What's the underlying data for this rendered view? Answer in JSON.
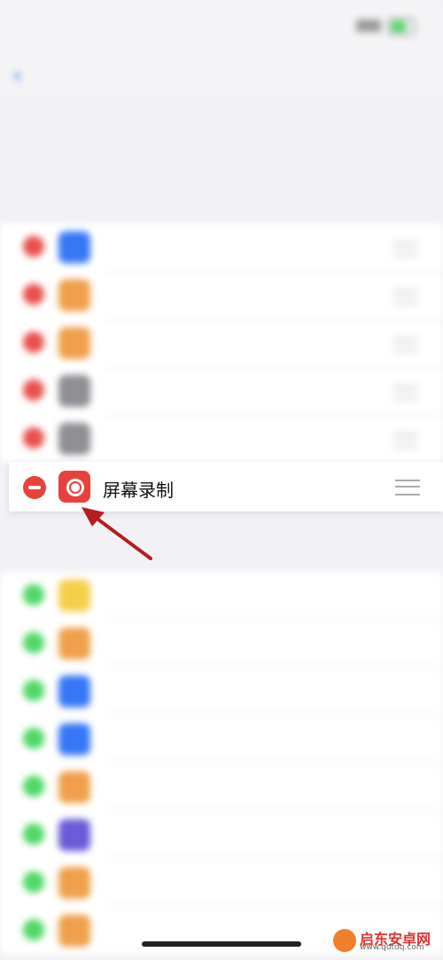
{
  "focus_item": {
    "label": "屏幕录制"
  },
  "colors": {
    "minus": "#e8413c",
    "plus": "#4cd964",
    "accent": "#3478f6"
  },
  "top_icon_colors": [
    "#3478f6",
    "#f0a04a",
    "#f0a04a",
    "#8e8e93",
    "#8e8e93"
  ],
  "bottom_icon_colors": [
    "#f6cf4a",
    "#f0a04a",
    "#3478f6",
    "#3478f6",
    "#f0a04a",
    "#6b5bd6",
    "#f0a04a",
    "#f0a04a"
  ],
  "watermark": {
    "name": "启东安卓网",
    "url": "www.qdtdq.com"
  }
}
